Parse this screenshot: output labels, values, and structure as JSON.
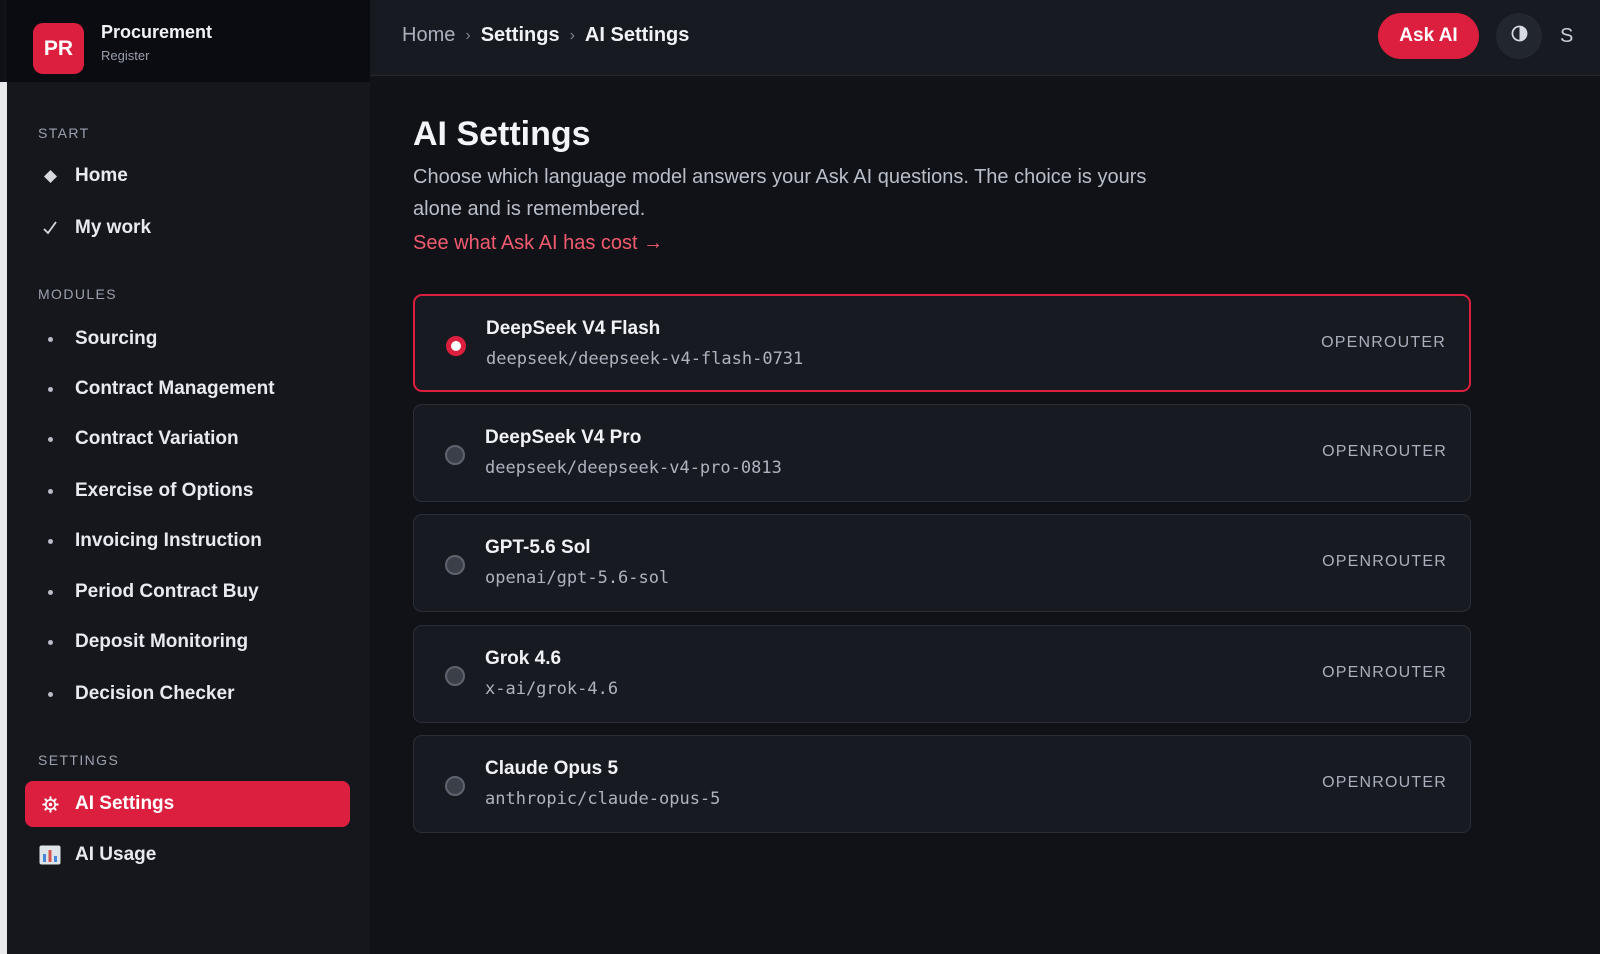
{
  "brand": {
    "badge": "PR",
    "title": "Procurement",
    "subtitle": "Register"
  },
  "sidebar": {
    "sections": {
      "start": "START",
      "modules": "MODULES",
      "settings": "SETTINGS"
    },
    "start_items": [
      {
        "label": "Home",
        "icon": "diamond-icon"
      },
      {
        "label": "My work",
        "icon": "check-icon"
      }
    ],
    "module_items": [
      {
        "label": "Sourcing"
      },
      {
        "label": "Contract Management"
      },
      {
        "label": "Contract Variation"
      },
      {
        "label": "Exercise of Options"
      },
      {
        "label": "Invoicing Instruction"
      },
      {
        "label": "Period Contract Buy"
      },
      {
        "label": "Deposit Monitoring"
      },
      {
        "label": "Decision Checker"
      }
    ],
    "settings_items": [
      {
        "label": "AI Settings",
        "icon": "gear-icon",
        "active": true
      },
      {
        "label": "AI Usage",
        "icon": "bar-chart-icon",
        "active": false
      }
    ]
  },
  "topbar": {
    "breadcrumb": [
      "Home",
      "Settings",
      "AI Settings"
    ],
    "ask_ai_label": "Ask AI",
    "truncated_text": "S"
  },
  "main": {
    "title": "AI Settings",
    "description": "Choose which language model answers your Ask AI questions. The choice is yours alone and is remembered.",
    "cost_link": "See what Ask AI has cost →",
    "models": [
      {
        "name": "DeepSeek V4 Flash",
        "id": "deepseek/deepseek-v4-flash-0731",
        "provider": "OPENROUTER",
        "selected": true
      },
      {
        "name": "DeepSeek V4 Pro",
        "id": "deepseek/deepseek-v4-pro-0813",
        "provider": "OPENROUTER",
        "selected": false
      },
      {
        "name": "GPT-5.6 Sol",
        "id": "openai/gpt-5.6-sol",
        "provider": "OPENROUTER",
        "selected": false
      },
      {
        "name": "Grok 4.6",
        "id": "x-ai/grok-4.6",
        "provider": "OPENROUTER",
        "selected": false
      },
      {
        "name": "Claude Opus 5",
        "id": "anthropic/claude-opus-5",
        "provider": "OPENROUTER",
        "selected": false
      }
    ]
  },
  "colors": {
    "accent": "#dc1f3e",
    "background": "#101218",
    "sidebar": "#15171d",
    "link": "#f25b6f"
  }
}
